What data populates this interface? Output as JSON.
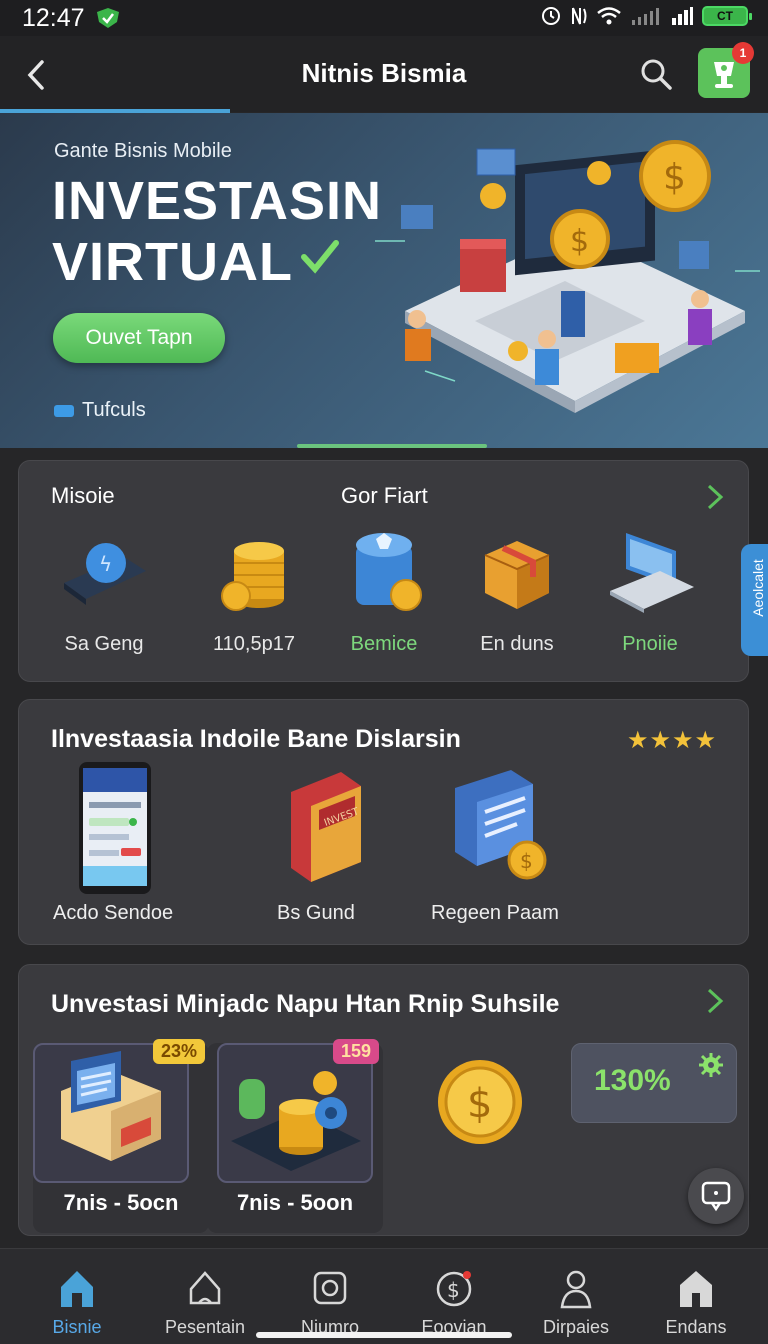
{
  "status_bar": {
    "time": "12:47",
    "battery_label": "CT"
  },
  "header": {
    "title": "Nitnis Bismia",
    "cart_badge": "1"
  },
  "hero": {
    "kicker": "Gante Bisnis Mobile",
    "title_line1": "INVESTASIN",
    "title_line2": "VIRTUAL",
    "cta_label": "Ouvet Tapn",
    "tutorial_label": "Tufculs"
  },
  "categories": {
    "label_left": "Misoie",
    "label_center": "Gor Fiart",
    "items": [
      {
        "label": "Sa Geng",
        "icon": "wallet-icon"
      },
      {
        "label": "110,5p17",
        "icon": "coin-stack-icon"
      },
      {
        "label": "Bemice",
        "icon": "database-coin-icon",
        "accent": "#7dd87d"
      },
      {
        "label": "En duns",
        "icon": "package-icon"
      },
      {
        "label": "Pnoiie",
        "icon": "laptop-icon",
        "accent": "#7dd87d"
      }
    ]
  },
  "side_tab": {
    "label": "Aeolcalet"
  },
  "featured": {
    "title": "Ilnvestaasia Indoile Bane Dislarsin",
    "rating": "★★★★",
    "rating_value": 4,
    "items": [
      {
        "label": "Acdo Sendoe",
        "icon": "phone-app-icon"
      },
      {
        "label": "Bs Gund",
        "icon": "book-icon"
      },
      {
        "label": "Regeen Paam",
        "icon": "document-coin-icon"
      }
    ]
  },
  "returns": {
    "title": "Unvestasi Minjadc Napu Htan Rnip Suhsile",
    "tiles": [
      {
        "tag": "23%",
        "label": "7nis - 5ocn",
        "icon": "server-box-icon"
      },
      {
        "tag": "159",
        "label": "7nis - 5oon",
        "icon": "coins-gear-icon"
      }
    ],
    "coin_icon": "gold-coin-icon",
    "roi_value": "130%"
  },
  "bottom_nav": [
    {
      "label": "Bisnie",
      "icon": "home-icon",
      "active": true
    },
    {
      "label": "Pesentain",
      "icon": "bell-house-icon",
      "active": false
    },
    {
      "label": "Niumro",
      "icon": "camera-icon",
      "active": false
    },
    {
      "label": "Eoovian",
      "icon": "dollar-icon",
      "active": false
    },
    {
      "label": "Dirpaies",
      "icon": "user-icon",
      "active": false
    },
    {
      "label": "Endans",
      "icon": "store-icon",
      "active": false
    }
  ],
  "colors": {
    "accent_green": "#5cc25b",
    "accent_blue": "#4aa3d8",
    "card_bg": "#3a3a3e",
    "gold": "#f3c23a"
  }
}
